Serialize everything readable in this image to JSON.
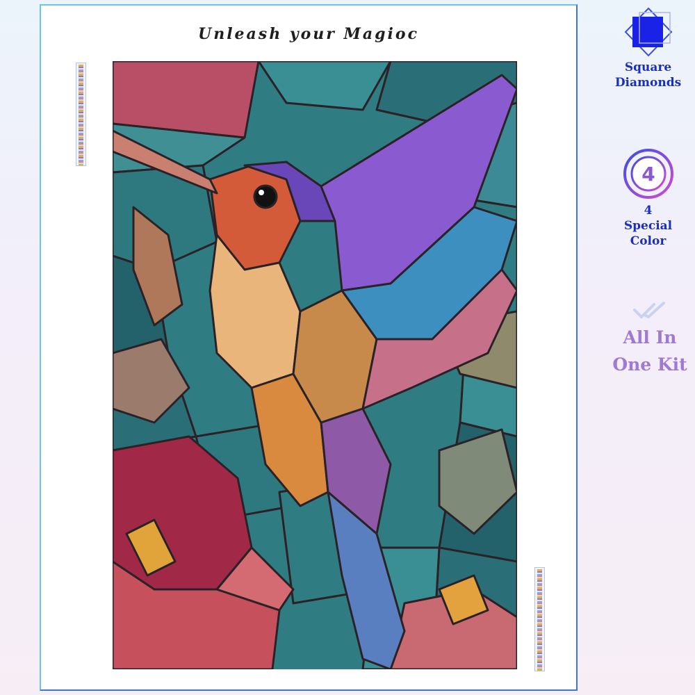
{
  "poster": {
    "headline": "Unleash your Magioc"
  },
  "features": [
    {
      "icon": "square-diamond-icon",
      "label_line1": "Square",
      "label_line2": "Diamonds",
      "color": "#1a2fbf"
    },
    {
      "icon": "number-badge-icon",
      "badge_text": "4",
      "label_line1": "4",
      "label_line2": "Special",
      "label_line3": "Color",
      "color": "#1a2fbf"
    },
    {
      "icon": "double-check-icon",
      "label_line1": "All In",
      "label_line2": "One Kit",
      "color": "#a07ad2"
    }
  ],
  "artwork": {
    "subject": "stained-glass hummingbird with flowers",
    "colors": {
      "teal": "#2f7c83",
      "dark_teal": "#1f5a63",
      "rose": "#c7505d",
      "magenta": "#a12947",
      "orange": "#d97a36",
      "violet": "#6a47b8",
      "lead_lines": "#2a2226"
    }
  }
}
